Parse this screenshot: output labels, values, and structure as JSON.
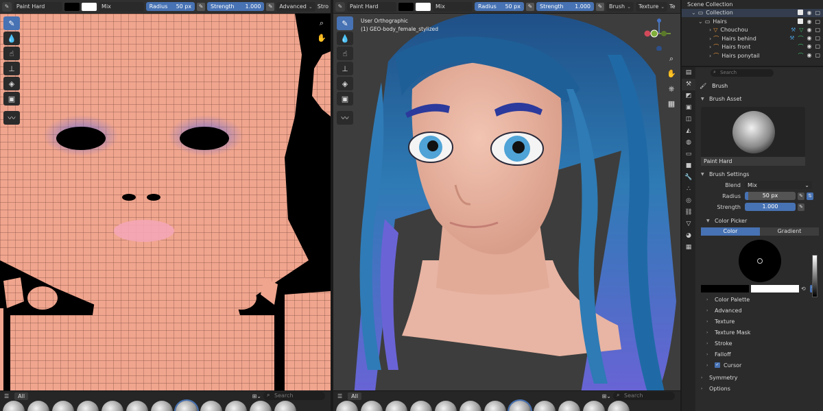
{
  "uv_header": {
    "brush": "Paint Hard",
    "blend": "Mix",
    "radius_label": "Radius",
    "radius_value": "50 px",
    "strength_label": "Strength",
    "strength_value": "1.000",
    "advanced": "Advanced",
    "overflow": "Stro"
  },
  "vp_header": {
    "brush": "Paint Hard",
    "blend": "Mix",
    "radius_label": "Radius",
    "radius_value": "50 px",
    "strength_label": "Strength",
    "strength_value": "1.000",
    "brush_menu": "Brush",
    "texture_menu": "Texture",
    "overflow": "Te"
  },
  "viewport": {
    "view_name": "User Orthographic",
    "object_name": "(1) GEO-body_female_stylized"
  },
  "shelf": {
    "tab_all": "All",
    "search_placeholder": "Search"
  },
  "outliner": {
    "root": "Scene Collection",
    "rows": [
      {
        "label": "Collection"
      },
      {
        "label": "Hairs"
      },
      {
        "label": "Chouchou"
      },
      {
        "label": "Hairs behind"
      },
      {
        "label": "Hairs front"
      },
      {
        "label": "Hairs ponytail"
      }
    ]
  },
  "props": {
    "search_placeholder": "Search",
    "title": "Brush",
    "brush_asset_section": "Brush Asset",
    "asset_name": "Paint Hard",
    "brush_settings_section": "Brush Settings",
    "blend_label": "Blend",
    "blend_value": "Mix",
    "radius_label": "Radius",
    "radius_value": "50 px",
    "strength_label": "Strength",
    "strength_value": "1.000",
    "color_picker_section": "Color Picker",
    "color_tab": "Color",
    "gradient_tab": "Gradient",
    "subsections": [
      "Color Palette",
      "Advanced",
      "Texture",
      "Texture Mask",
      "Stroke",
      "Falloff",
      "Cursor"
    ],
    "symmetry": "Symmetry",
    "options": "Options"
  },
  "colors": {
    "accent": "#4772b3",
    "skin": "#f0a58e",
    "hair": "#2e6fa8",
    "hair_tips": "#6a63d6",
    "viewport_bg": "#3d3d3d"
  }
}
